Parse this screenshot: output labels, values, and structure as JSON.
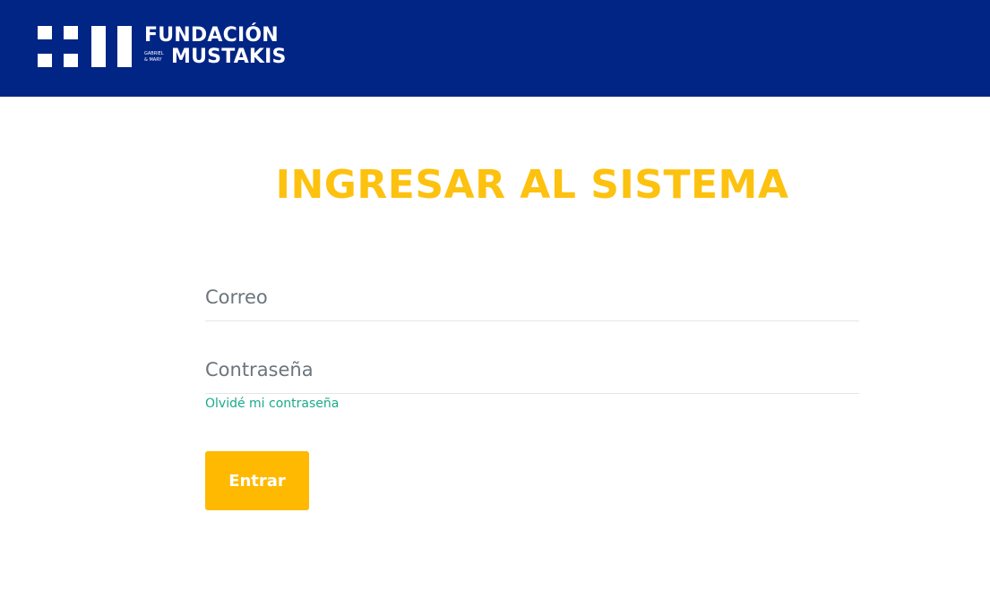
{
  "header": {
    "background_color": "#012585",
    "logo": {
      "name_line1": "FUNDACIÓN",
      "name_line2": "MUSTAKIS",
      "small_line1": "GABRIEL",
      "small_line2": "& MARY"
    }
  },
  "login": {
    "title": "INGRESAR AL SISTEMA",
    "email_placeholder": "Correo",
    "password_placeholder": "Contraseña",
    "forgot_link": "Olvidé mi contraseña",
    "submit_label": "Entrar"
  },
  "colors": {
    "title": "#fdc10f",
    "button": "#ffb900",
    "link": "#1aaa8b"
  }
}
